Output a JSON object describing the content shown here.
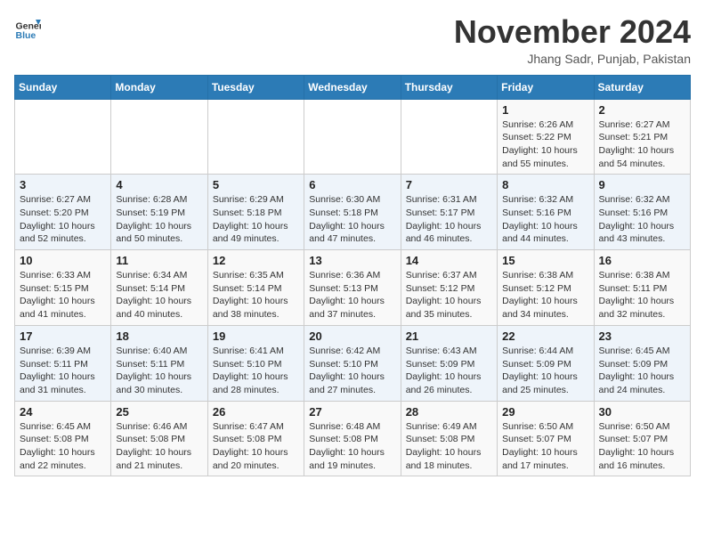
{
  "header": {
    "logo_line1": "General",
    "logo_line2": "Blue",
    "month": "November 2024",
    "location": "Jhang Sadr, Punjab, Pakistan"
  },
  "weekdays": [
    "Sunday",
    "Monday",
    "Tuesday",
    "Wednesday",
    "Thursday",
    "Friday",
    "Saturday"
  ],
  "weeks": [
    [
      {
        "day": "",
        "info": ""
      },
      {
        "day": "",
        "info": ""
      },
      {
        "day": "",
        "info": ""
      },
      {
        "day": "",
        "info": ""
      },
      {
        "day": "",
        "info": ""
      },
      {
        "day": "1",
        "info": "Sunrise: 6:26 AM\nSunset: 5:22 PM\nDaylight: 10 hours\nand 55 minutes."
      },
      {
        "day": "2",
        "info": "Sunrise: 6:27 AM\nSunset: 5:21 PM\nDaylight: 10 hours\nand 54 minutes."
      }
    ],
    [
      {
        "day": "3",
        "info": "Sunrise: 6:27 AM\nSunset: 5:20 PM\nDaylight: 10 hours\nand 52 minutes."
      },
      {
        "day": "4",
        "info": "Sunrise: 6:28 AM\nSunset: 5:19 PM\nDaylight: 10 hours\nand 50 minutes."
      },
      {
        "day": "5",
        "info": "Sunrise: 6:29 AM\nSunset: 5:18 PM\nDaylight: 10 hours\nand 49 minutes."
      },
      {
        "day": "6",
        "info": "Sunrise: 6:30 AM\nSunset: 5:18 PM\nDaylight: 10 hours\nand 47 minutes."
      },
      {
        "day": "7",
        "info": "Sunrise: 6:31 AM\nSunset: 5:17 PM\nDaylight: 10 hours\nand 46 minutes."
      },
      {
        "day": "8",
        "info": "Sunrise: 6:32 AM\nSunset: 5:16 PM\nDaylight: 10 hours\nand 44 minutes."
      },
      {
        "day": "9",
        "info": "Sunrise: 6:32 AM\nSunset: 5:16 PM\nDaylight: 10 hours\nand 43 minutes."
      }
    ],
    [
      {
        "day": "10",
        "info": "Sunrise: 6:33 AM\nSunset: 5:15 PM\nDaylight: 10 hours\nand 41 minutes."
      },
      {
        "day": "11",
        "info": "Sunrise: 6:34 AM\nSunset: 5:14 PM\nDaylight: 10 hours\nand 40 minutes."
      },
      {
        "day": "12",
        "info": "Sunrise: 6:35 AM\nSunset: 5:14 PM\nDaylight: 10 hours\nand 38 minutes."
      },
      {
        "day": "13",
        "info": "Sunrise: 6:36 AM\nSunset: 5:13 PM\nDaylight: 10 hours\nand 37 minutes."
      },
      {
        "day": "14",
        "info": "Sunrise: 6:37 AM\nSunset: 5:12 PM\nDaylight: 10 hours\nand 35 minutes."
      },
      {
        "day": "15",
        "info": "Sunrise: 6:38 AM\nSunset: 5:12 PM\nDaylight: 10 hours\nand 34 minutes."
      },
      {
        "day": "16",
        "info": "Sunrise: 6:38 AM\nSunset: 5:11 PM\nDaylight: 10 hours\nand 32 minutes."
      }
    ],
    [
      {
        "day": "17",
        "info": "Sunrise: 6:39 AM\nSunset: 5:11 PM\nDaylight: 10 hours\nand 31 minutes."
      },
      {
        "day": "18",
        "info": "Sunrise: 6:40 AM\nSunset: 5:11 PM\nDaylight: 10 hours\nand 30 minutes."
      },
      {
        "day": "19",
        "info": "Sunrise: 6:41 AM\nSunset: 5:10 PM\nDaylight: 10 hours\nand 28 minutes."
      },
      {
        "day": "20",
        "info": "Sunrise: 6:42 AM\nSunset: 5:10 PM\nDaylight: 10 hours\nand 27 minutes."
      },
      {
        "day": "21",
        "info": "Sunrise: 6:43 AM\nSunset: 5:09 PM\nDaylight: 10 hours\nand 26 minutes."
      },
      {
        "day": "22",
        "info": "Sunrise: 6:44 AM\nSunset: 5:09 PM\nDaylight: 10 hours\nand 25 minutes."
      },
      {
        "day": "23",
        "info": "Sunrise: 6:45 AM\nSunset: 5:09 PM\nDaylight: 10 hours\nand 24 minutes."
      }
    ],
    [
      {
        "day": "24",
        "info": "Sunrise: 6:45 AM\nSunset: 5:08 PM\nDaylight: 10 hours\nand 22 minutes."
      },
      {
        "day": "25",
        "info": "Sunrise: 6:46 AM\nSunset: 5:08 PM\nDaylight: 10 hours\nand 21 minutes."
      },
      {
        "day": "26",
        "info": "Sunrise: 6:47 AM\nSunset: 5:08 PM\nDaylight: 10 hours\nand 20 minutes."
      },
      {
        "day": "27",
        "info": "Sunrise: 6:48 AM\nSunset: 5:08 PM\nDaylight: 10 hours\nand 19 minutes."
      },
      {
        "day": "28",
        "info": "Sunrise: 6:49 AM\nSunset: 5:08 PM\nDaylight: 10 hours\nand 18 minutes."
      },
      {
        "day": "29",
        "info": "Sunrise: 6:50 AM\nSunset: 5:07 PM\nDaylight: 10 hours\nand 17 minutes."
      },
      {
        "day": "30",
        "info": "Sunrise: 6:50 AM\nSunset: 5:07 PM\nDaylight: 10 hours\nand 16 minutes."
      }
    ]
  ]
}
